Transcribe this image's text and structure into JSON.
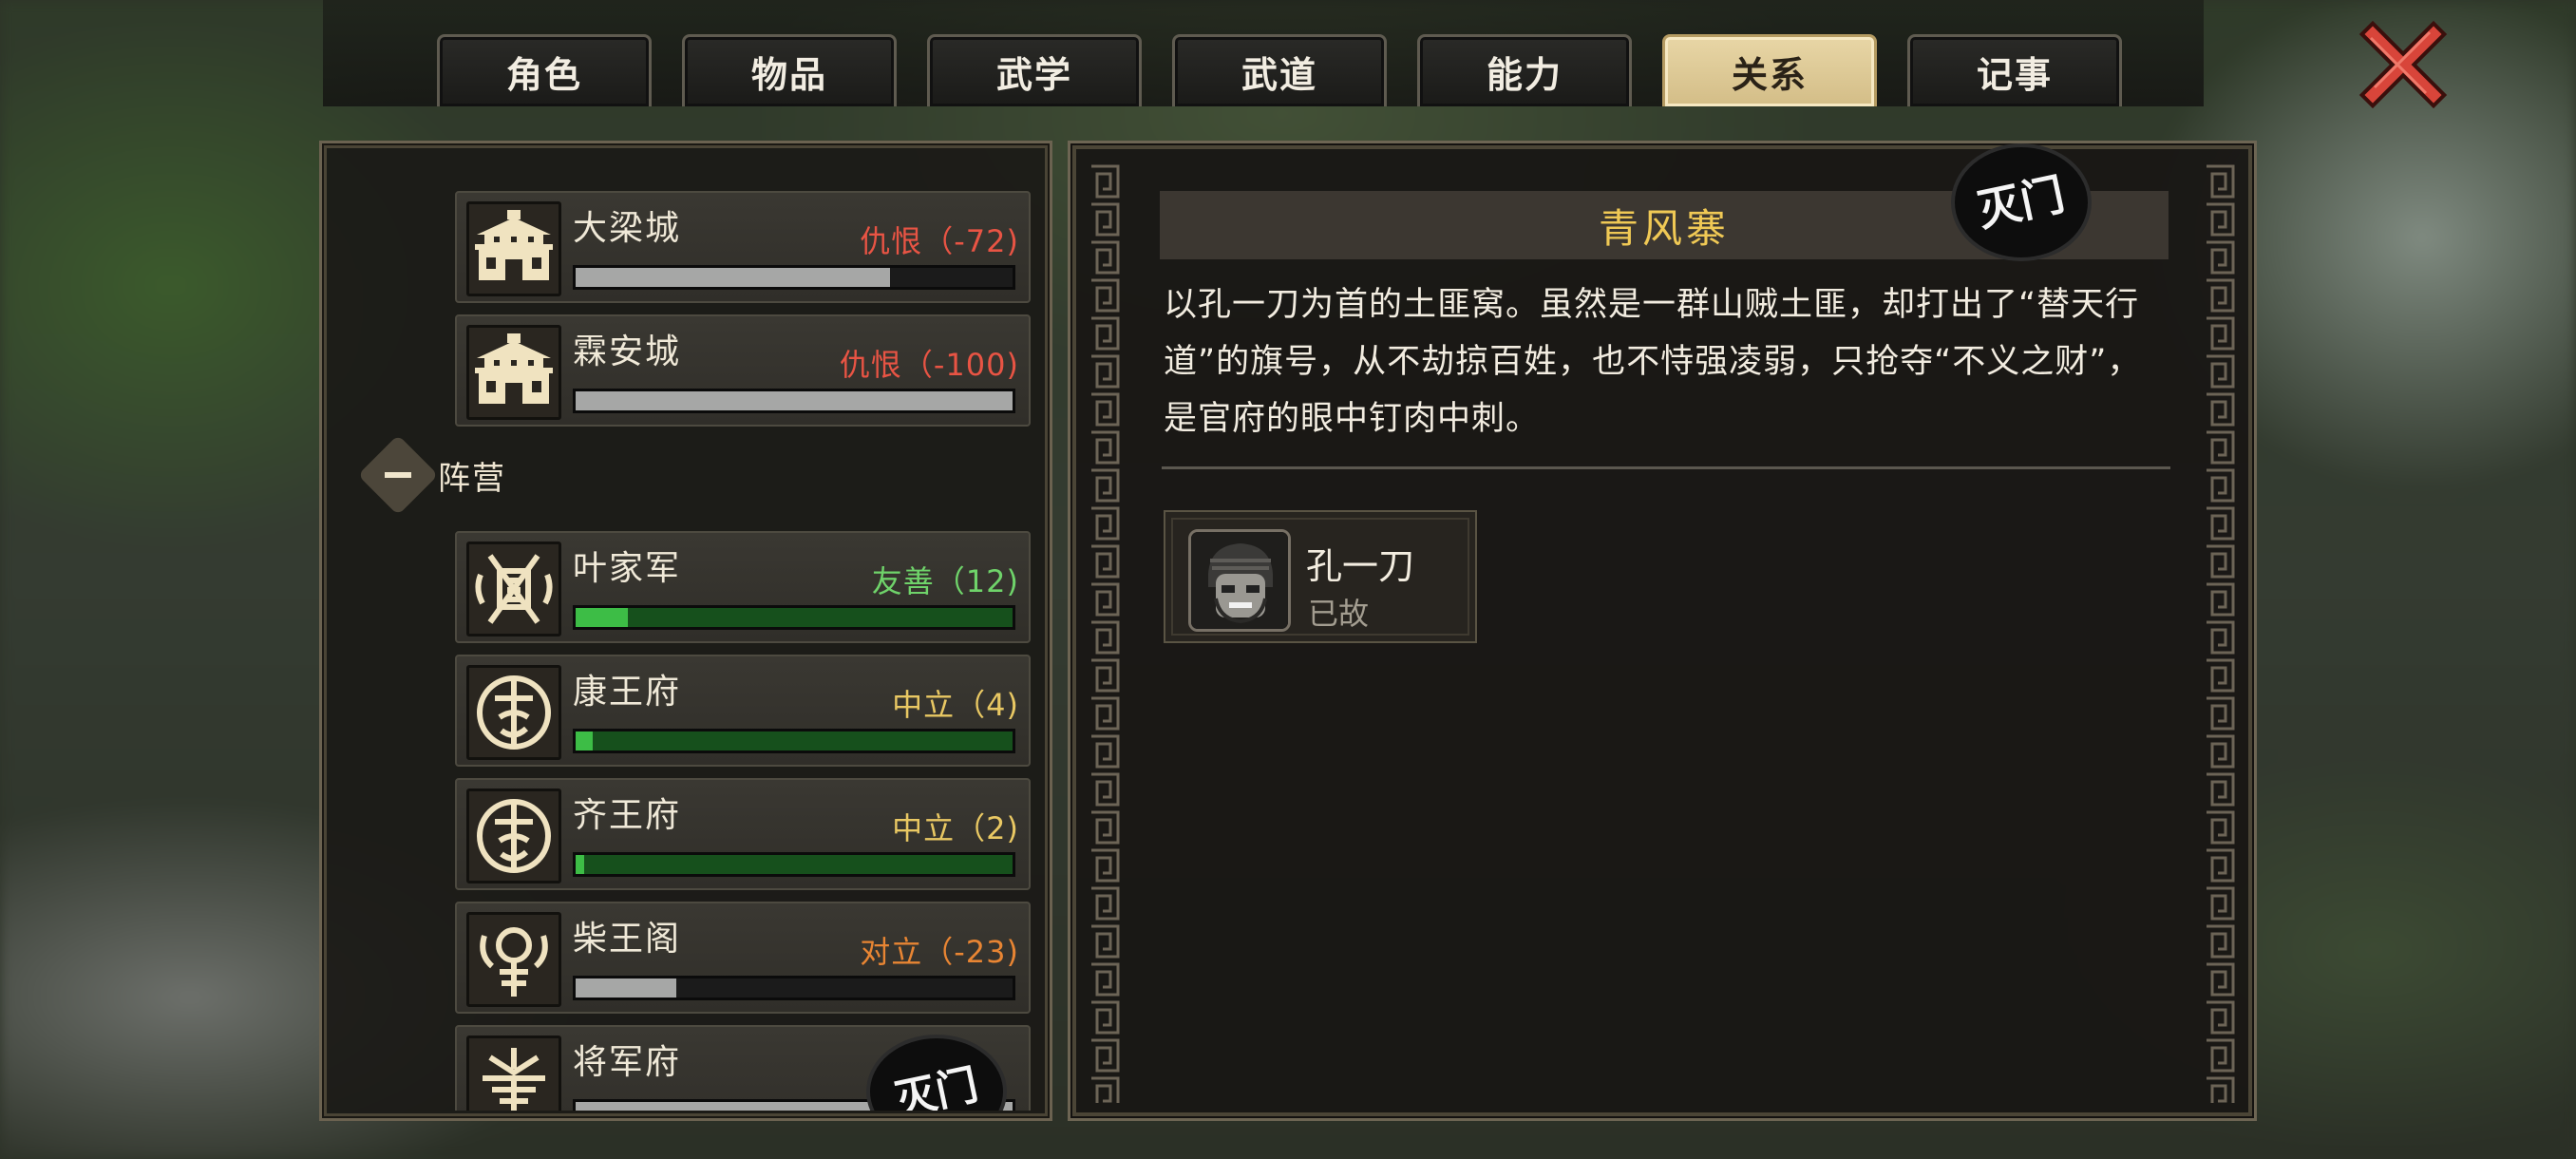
{
  "tabs": [
    {
      "label": "角色",
      "active": false
    },
    {
      "label": "物品",
      "active": false
    },
    {
      "label": "武学",
      "active": false
    },
    {
      "label": "武道",
      "active": false
    },
    {
      "label": "能力",
      "active": false
    },
    {
      "label": "关系",
      "active": true
    },
    {
      "label": "记事",
      "active": false
    }
  ],
  "colors": {
    "hostile": "#e85444",
    "friendly": "#6fd36a",
    "neutral": "#e9c863",
    "opposed": "#e88533",
    "bar_gray": "#a6a7a6",
    "bar_green": "#16501c",
    "bar_green_fill": "#3dbd46",
    "accent_gold": "#f0c955",
    "tab_active": "#dcc794"
  },
  "factions_top": [
    {
      "name": "大梁城",
      "status": "仇恨（-72)",
      "tone": "hostile",
      "icon": "city-gate-icon",
      "bar_fraction": 0.72,
      "bar_kind": "gray"
    },
    {
      "name": "霖安城",
      "status": "仇恨（-100)",
      "tone": "hostile",
      "icon": "city-gate-icon",
      "bar_fraction": 1.0,
      "bar_kind": "gray"
    }
  ],
  "group": {
    "label": "阵营"
  },
  "factions": [
    {
      "name": "叶家军",
      "status": "友善（12)",
      "tone": "friendly",
      "icon": "army-crest-icon",
      "bar_fraction": 0.12,
      "bar_kind": "green"
    },
    {
      "name": "康王府",
      "status": "中立（4)",
      "tone": "neutral",
      "icon": "prince-seal-icon",
      "bar_fraction": 0.04,
      "bar_kind": "green"
    },
    {
      "name": "齐王府",
      "status": "中立（2)",
      "tone": "neutral",
      "icon": "prince-seal-icon",
      "bar_fraction": 0.02,
      "bar_kind": "green"
    },
    {
      "name": "柴王阁",
      "status": "对立（-23)",
      "tone": "opposed",
      "icon": "pavilion-crest-icon",
      "bar_fraction": 0.23,
      "bar_kind": "gray"
    },
    {
      "name": "将军府",
      "status": "",
      "tone": "hostile",
      "icon": "general-crest-icon",
      "bar_fraction": 1.0,
      "bar_kind": "gray",
      "stamp": "灭门"
    }
  ],
  "detail": {
    "title": "青风寨",
    "stamp": "灭门",
    "description": "以孔一刀为首的土匪窝。虽然是一群山贼土匪，却打出了“替天行道”的旗号，从不劫掠百姓，也不恃强凌弱，只抢夺“不义之财”，是官府的眼中钉肉中刺。",
    "members": [
      {
        "name": "孔一刀",
        "status": "已故"
      }
    ]
  }
}
